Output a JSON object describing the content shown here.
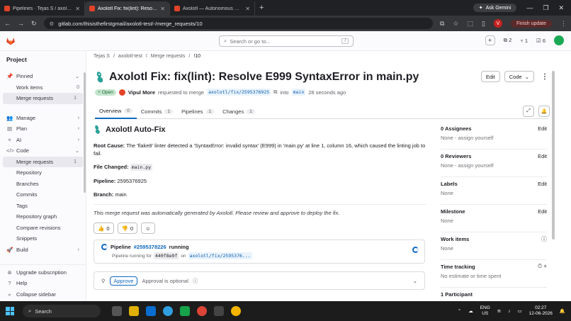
{
  "browser": {
    "tabs": [
      {
        "title": "Pipelines · Tejas S / axolotl-tes",
        "favicon_color": "#e24329",
        "active": false
      },
      {
        "title": "Axolotl Fix: fix(lint): Resolve",
        "favicon_color": "#e24329",
        "active": true
      },
      {
        "title": "Axolotl — Autonomous CI/CD F",
        "favicon_color": "#e24329",
        "active": false
      }
    ],
    "ask_gemini": "Ask Gemini",
    "url": "gitlab.com/thisisthefirstgmail/axolotl-test/-/merge_requests/10",
    "profile_letter": "V",
    "finish_update": "Finish update"
  },
  "gitlab_top": {
    "search_placeholder": "Search or go to...",
    "search_shortcut": "/",
    "issues_count": "2",
    "mrs_count": "1",
    "todos_count": "6"
  },
  "sidebar": {
    "section_title": "Project",
    "items": [
      {
        "label": "Pinned",
        "icon": "pin-icon",
        "type": "section"
      },
      {
        "label": "Work items",
        "count": "0",
        "type": "sub"
      },
      {
        "label": "Merge requests",
        "count": "1",
        "type": "sub-active"
      },
      {
        "label": "Manage",
        "icon": "users-icon",
        "type": "section"
      },
      {
        "label": "Plan",
        "icon": "plan-icon",
        "type": "section"
      },
      {
        "label": "AI",
        "icon": "ai-icon",
        "type": "section"
      },
      {
        "label": "Code",
        "icon": "code-icon",
        "type": "section-open"
      },
      {
        "label": "Merge requests",
        "count": "1",
        "type": "sub-active"
      },
      {
        "label": "Repository",
        "type": "sub"
      },
      {
        "label": "Branches",
        "type": "sub"
      },
      {
        "label": "Commits",
        "type": "sub"
      },
      {
        "label": "Tags",
        "type": "sub"
      },
      {
        "label": "Repository graph",
        "type": "sub"
      },
      {
        "label": "Compare revisions",
        "type": "sub"
      },
      {
        "label": "Snippets",
        "type": "sub"
      },
      {
        "label": "Build",
        "icon": "rocket-icon",
        "type": "section"
      }
    ],
    "bottom": [
      {
        "label": "Upgrade subscription",
        "icon": "upgrade-icon"
      },
      {
        "label": "Help",
        "icon": "help-icon"
      },
      {
        "label": "Collapse sidebar",
        "icon": "collapse-icon"
      }
    ]
  },
  "breadcrumb": [
    "Tejas S",
    "axolotl-test",
    "Merge requests",
    "!10"
  ],
  "mr": {
    "title": "Axolotl Fix: fix(lint): Resolve E999 SyntaxError in main.py",
    "edit_label": "Edit",
    "code_label": "Code",
    "status": "Open",
    "author": "Vipul More",
    "requested_text": "requested to merge",
    "source_branch": "axolotl/fix/2595376925",
    "into_text": "into",
    "target_branch": "main",
    "time_ago": "28 seconds ago"
  },
  "tabs": [
    {
      "label": "Overview",
      "count": "0",
      "active": true
    },
    {
      "label": "Commits",
      "count": "1",
      "active": false
    },
    {
      "label": "Pipelines",
      "count": "1",
      "active": false
    },
    {
      "label": "Changes",
      "count": "1",
      "active": false
    }
  ],
  "description": {
    "heading": "Axolotl Auto-Fix",
    "root_cause_label": "Root Cause:",
    "root_cause_text": "The 'flake8' linter detected a 'SyntaxError: invalid syntax' (E999) in 'main.py' at line 1, column 16, which caused the linting job to fail.",
    "file_changed_label": "File Changed:",
    "file_changed": "main.py",
    "pipeline_label": "Pipeline:",
    "pipeline": "2595376925",
    "branch_label": "Branch:",
    "branch": "main",
    "footer": "This merge request was automatically generated by Axolotl. Please review and approve to deploy the fix.",
    "thumbs_up": "0",
    "thumbs_down": "0"
  },
  "pipeline_widget": {
    "prefix": "Pipeline",
    "id": "#2595378226",
    "status": "running",
    "sub_text": "Pipeline running for",
    "commit": "440f8e9f",
    "on_text": "on",
    "branch": "axolotl/fix/2595376..."
  },
  "approval": {
    "button": "Approve",
    "text": "Approval is optional"
  },
  "right_sidebar": [
    {
      "heading": "0 Assignees",
      "value": "None - assign yourself",
      "action": "Edit"
    },
    {
      "heading": "0 Reviewers",
      "value": "None - assign yourself",
      "action": "Edit"
    },
    {
      "heading": "Labels",
      "value": "None",
      "action": "Edit"
    },
    {
      "heading": "Milestone",
      "value": "None",
      "action": "Edit"
    },
    {
      "heading": "Work items",
      "value": "None",
      "action": ""
    },
    {
      "heading": "Time tracking",
      "value": "No estimate or time spent",
      "action": ""
    },
    {
      "heading": "1 Participant",
      "value": "",
      "action": ""
    }
  ],
  "taskbar": {
    "search": "Search",
    "lang_top": "ENG",
    "lang_bottom": "US",
    "time": "02:27",
    "date": "12-06-2026"
  }
}
